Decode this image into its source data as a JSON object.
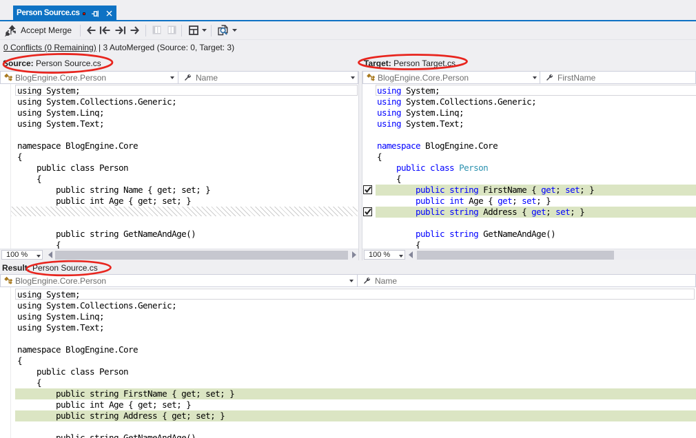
{
  "colors": {
    "chrome": "#EFEFF2",
    "tab-blue": "#0E72C4",
    "tab-text": "#FFFFFF",
    "toolbar-icon": "#404045",
    "text": "#1E1E1E",
    "nav-text": "#6D6D6D",
    "navbar-border": "#CCCEDB",
    "keyword": "#0000FF",
    "type-name": "#2B91AF",
    "green": "#DBE5C3",
    "annotation-red": "#E8251E",
    "class-icon": "#A8791F",
    "mag-blue": "#2D6DA4"
  },
  "tab": {
    "title": "Person Source.cs"
  },
  "toolbar": {
    "accept_merge_label": "Accept Merge"
  },
  "status_bar": {
    "conflicts_link": "0 Conflicts (0 Remaining)",
    "divider": " | ",
    "automerged_text": "3 AutoMerged (Source: 0, Target: 3)"
  },
  "source_pane": {
    "label": "Source:",
    "filename": "Person Source.cs",
    "scope_dropdown": "BlogEngine.Core.Person",
    "member_dropdown": "Name",
    "zoom_level": "100 %"
  },
  "target_pane": {
    "label": "Target:",
    "filename": "Person Target.cs",
    "scope_dropdown": "BlogEngine.Core.Person",
    "member_dropdown": "FirstName",
    "zoom_level": "100 %"
  },
  "result_pane": {
    "label": "Result:",
    "filename": "Person Source.cs",
    "scope_dropdown": "BlogEngine.Core.Person",
    "member_dropdown": "Name"
  },
  "code": {
    "source": {
      "caret_row": 0,
      "lines": [
        {
          "tokens": [
            [
              "p",
              "using System;"
            ]
          ]
        },
        {
          "tokens": [
            [
              "p",
              "using System.Collections.Generic;"
            ]
          ]
        },
        {
          "tokens": [
            [
              "p",
              "using System.Linq;"
            ]
          ]
        },
        {
          "tokens": [
            [
              "p",
              "using System.Text;"
            ]
          ]
        },
        {
          "tokens": []
        },
        {
          "tokens": [
            [
              "p",
              "namespace BlogEngine.Core"
            ]
          ]
        },
        {
          "tokens": [
            [
              "p",
              "{"
            ]
          ]
        },
        {
          "tokens": [
            [
              "p",
              "    public class Person"
            ]
          ]
        },
        {
          "tokens": [
            [
              "p",
              "    {"
            ]
          ]
        },
        {
          "tokens": [
            [
              "p",
              "        public string Name { get; set; }"
            ]
          ]
        },
        {
          "tokens": [
            [
              "p",
              "        public int Age { get; set; }"
            ]
          ]
        },
        {
          "hatch": true
        },
        {
          "tokens": []
        },
        {
          "tokens": [
            [
              "p",
              "        public string GetNameAndAge()"
            ]
          ]
        },
        {
          "tokens": [
            [
              "p",
              "        {"
            ]
          ]
        }
      ]
    },
    "target": {
      "caret_row": 0,
      "checked_rows": [
        9,
        11
      ],
      "lines": [
        {
          "tokens": [
            [
              "k",
              "using"
            ],
            [
              "p",
              " System;"
            ]
          ]
        },
        {
          "tokens": [
            [
              "k",
              "using"
            ],
            [
              "p",
              " System.Collections.Generic;"
            ]
          ]
        },
        {
          "tokens": [
            [
              "k",
              "using"
            ],
            [
              "p",
              " System.Linq;"
            ]
          ]
        },
        {
          "tokens": [
            [
              "k",
              "using"
            ],
            [
              "p",
              " System.Text;"
            ]
          ]
        },
        {
          "tokens": []
        },
        {
          "tokens": [
            [
              "k",
              "namespace"
            ],
            [
              "p",
              " BlogEngine.Core"
            ]
          ]
        },
        {
          "tokens": [
            [
              "p",
              "{"
            ]
          ]
        },
        {
          "tokens": [
            [
              "p",
              "    "
            ],
            [
              "k",
              "public"
            ],
            [
              "p",
              " "
            ],
            [
              "k",
              "class"
            ],
            [
              "p",
              " "
            ],
            [
              "t",
              "Person"
            ]
          ]
        },
        {
          "tokens": [
            [
              "p",
              "    {"
            ]
          ]
        },
        {
          "highlight": "green",
          "tokens": [
            [
              "p",
              "        "
            ],
            [
              "k",
              "public"
            ],
            [
              "p",
              " "
            ],
            [
              "k",
              "string"
            ],
            [
              "p",
              " FirstName { "
            ],
            [
              "k",
              "get"
            ],
            [
              "p",
              "; "
            ],
            [
              "k",
              "set"
            ],
            [
              "p",
              "; }"
            ]
          ]
        },
        {
          "tokens": [
            [
              "p",
              "        "
            ],
            [
              "k",
              "public"
            ],
            [
              "p",
              " "
            ],
            [
              "k",
              "int"
            ],
            [
              "p",
              " Age { "
            ],
            [
              "k",
              "get"
            ],
            [
              "p",
              "; "
            ],
            [
              "k",
              "set"
            ],
            [
              "p",
              "; }"
            ]
          ]
        },
        {
          "highlight": "green",
          "tokens": [
            [
              "p",
              "        "
            ],
            [
              "k",
              "public"
            ],
            [
              "p",
              " "
            ],
            [
              "k",
              "string"
            ],
            [
              "p",
              " Address { "
            ],
            [
              "k",
              "get"
            ],
            [
              "p",
              "; "
            ],
            [
              "k",
              "set"
            ],
            [
              "p",
              "; }"
            ]
          ]
        },
        {
          "tokens": []
        },
        {
          "tokens": [
            [
              "p",
              "        "
            ],
            [
              "k",
              "public"
            ],
            [
              "p",
              " "
            ],
            [
              "k",
              "string"
            ],
            [
              "p",
              " GetNameAndAge()"
            ]
          ]
        },
        {
          "tokens": [
            [
              "p",
              "        {"
            ]
          ]
        }
      ]
    },
    "result": {
      "caret_row": 0,
      "lines": [
        {
          "tokens": [
            [
              "p",
              "using System;"
            ]
          ]
        },
        {
          "tokens": [
            [
              "p",
              "using System.Collections.Generic;"
            ]
          ]
        },
        {
          "tokens": [
            [
              "p",
              "using System.Linq;"
            ]
          ]
        },
        {
          "tokens": [
            [
              "p",
              "using System.Text;"
            ]
          ]
        },
        {
          "tokens": []
        },
        {
          "tokens": [
            [
              "p",
              "namespace BlogEngine.Core"
            ]
          ]
        },
        {
          "tokens": [
            [
              "p",
              "{"
            ]
          ]
        },
        {
          "tokens": [
            [
              "p",
              "    public class Person"
            ]
          ]
        },
        {
          "tokens": [
            [
              "p",
              "    {"
            ]
          ]
        },
        {
          "highlight": "green",
          "tokens": [
            [
              "p",
              "        public string FirstName { get; set; }"
            ]
          ]
        },
        {
          "tokens": [
            [
              "p",
              "        public int Age { get; set; }"
            ]
          ]
        },
        {
          "highlight": "green",
          "tokens": [
            [
              "p",
              "        public string Address { get; set; }"
            ]
          ]
        },
        {
          "tokens": []
        },
        {
          "tokens": [
            [
              "p",
              "        public string GetNameAndAge()"
            ]
          ]
        }
      ]
    }
  }
}
